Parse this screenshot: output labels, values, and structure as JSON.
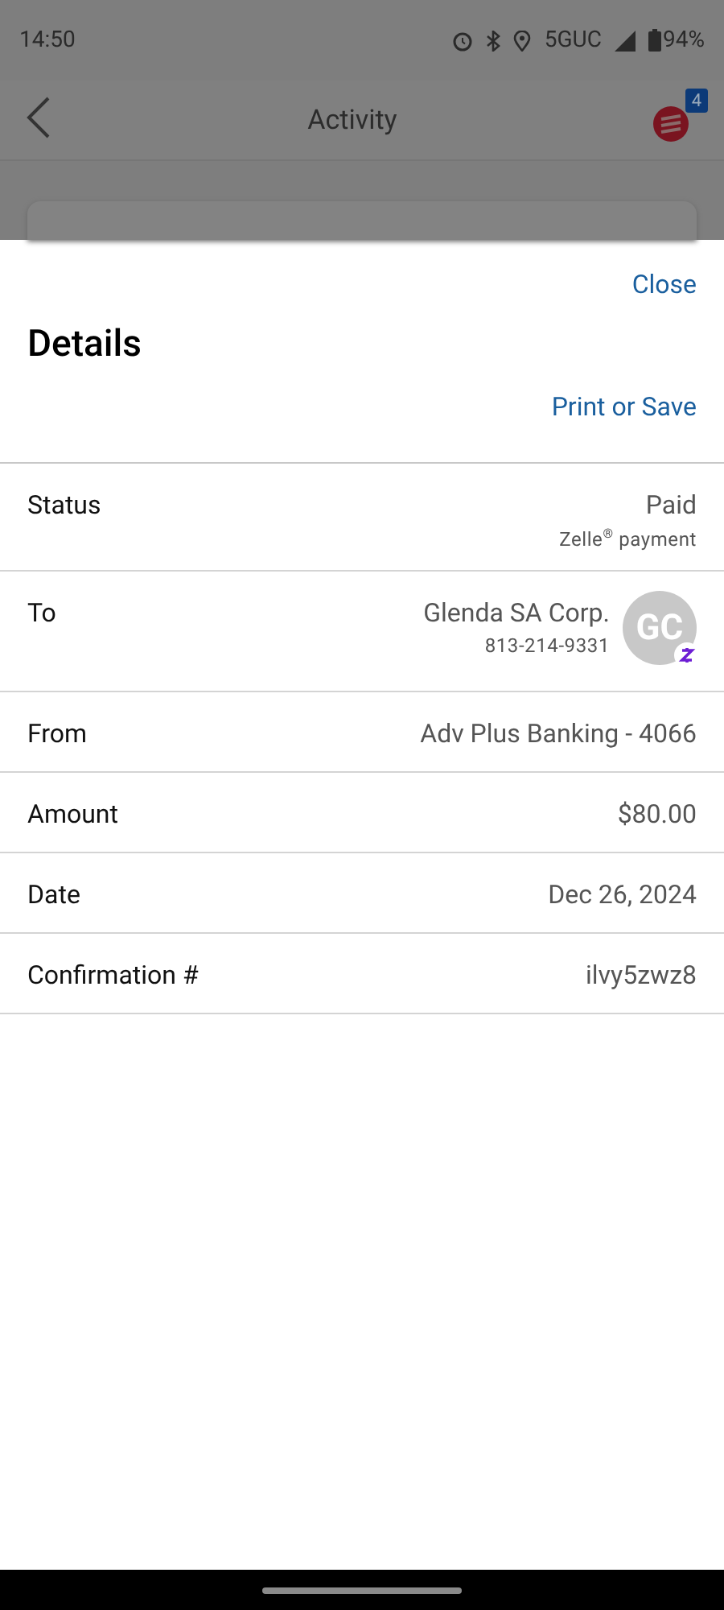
{
  "status_bar": {
    "time": "14:50",
    "network": "5GUC",
    "battery": "94%"
  },
  "header": {
    "title": "Activity",
    "badge": "4"
  },
  "sheet": {
    "close": "Close",
    "title": "Details",
    "print": "Print or Save",
    "rows": [
      {
        "kind": "status",
        "label": "Status",
        "value": "Paid",
        "note": "Zelle$^{®}$ payment"
      },
      {
        "kind": "payee",
        "label": "To",
        "value": "Glenda SA Corp.",
        "note": "813-214-9331",
        "initials": "GC"
      },
      {
        "kind": "plain",
        "label": "From",
        "value": "Adv Plus Banking - 4066"
      },
      {
        "kind": "plain",
        "label": "Amount",
        "value": "$80.00"
      },
      {
        "kind": "plain",
        "label": "Date",
        "value": "Dec 26, 2024"
      },
      {
        "kind": "plain",
        "label": "Confirmation #",
        "value": "ilvy5zwz8"
      }
    ]
  }
}
